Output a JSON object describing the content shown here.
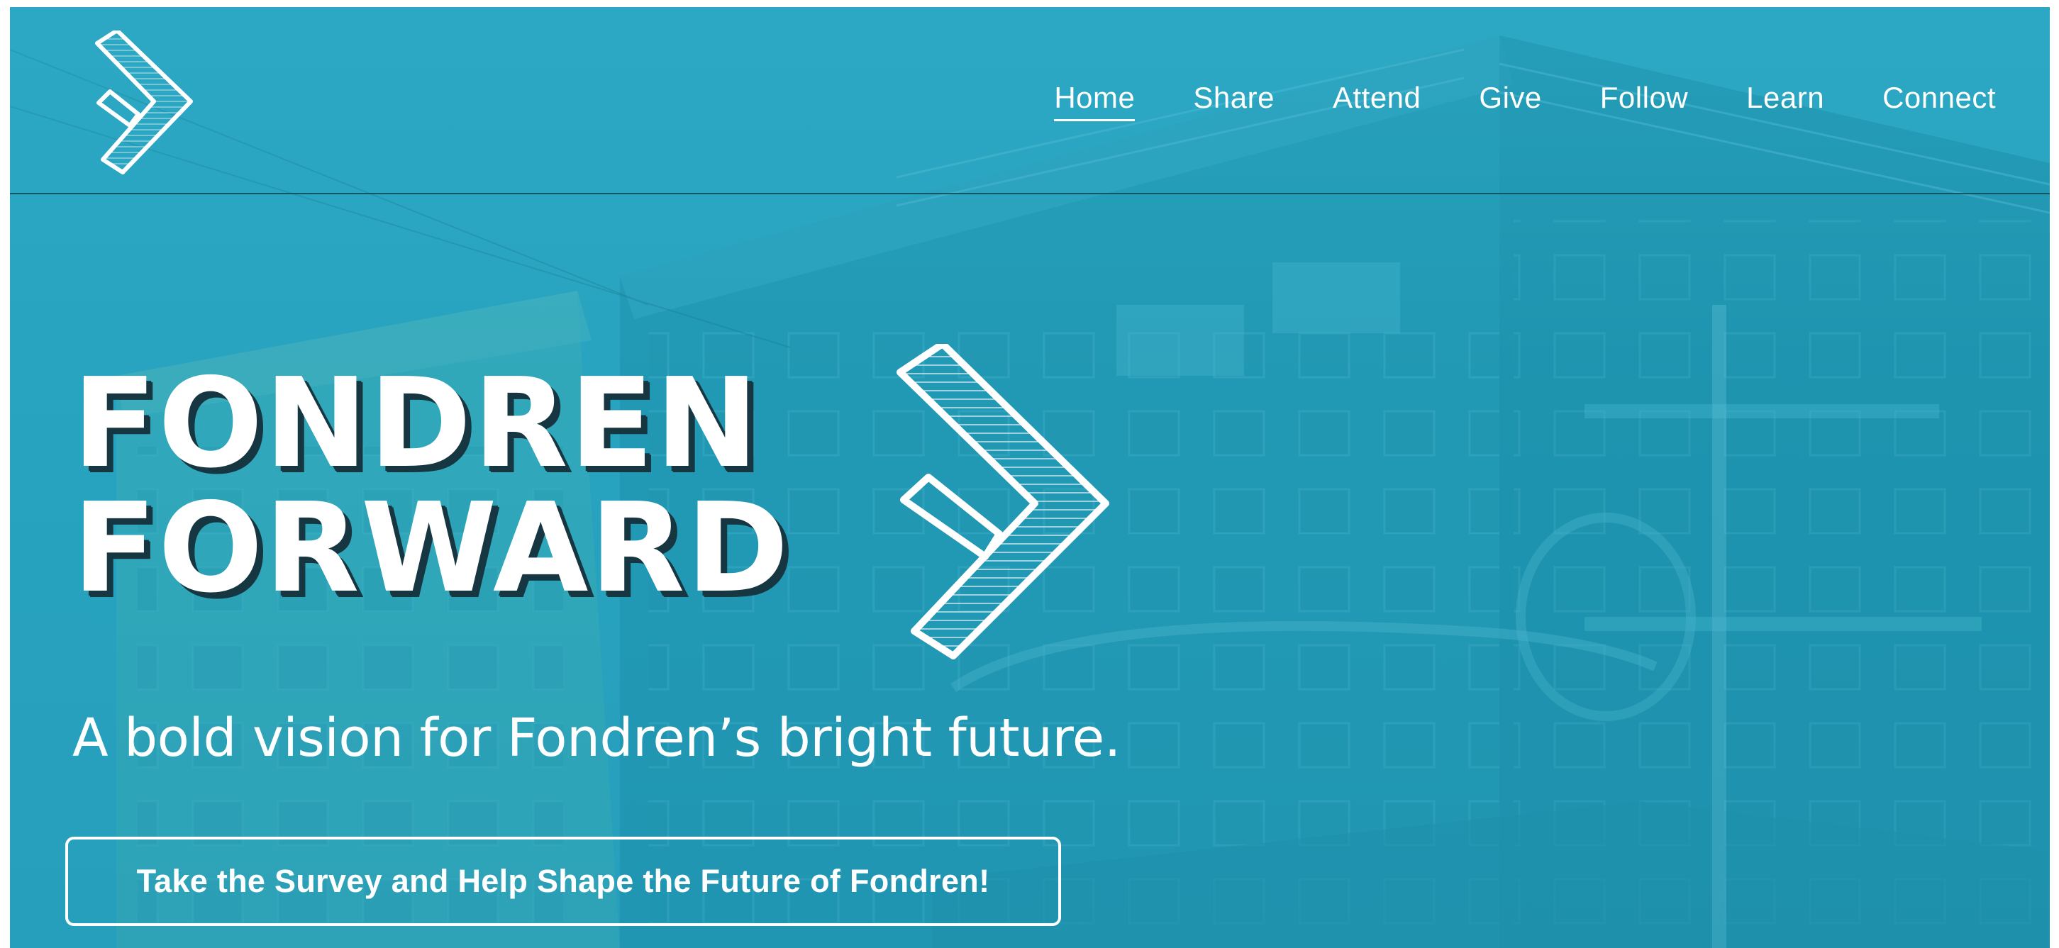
{
  "brand": {
    "logo_icon": "chevron-arrow-logo"
  },
  "nav": {
    "items": [
      {
        "label": "Home",
        "active": true
      },
      {
        "label": "Share",
        "active": false
      },
      {
        "label": "Attend",
        "active": false
      },
      {
        "label": "Give",
        "active": false
      },
      {
        "label": "Follow",
        "active": false
      },
      {
        "label": "Learn",
        "active": false
      },
      {
        "label": "Connect",
        "active": false
      }
    ]
  },
  "hero": {
    "title_line1": "FONDREN",
    "title_line2": "FORWARD",
    "tagline": "A bold vision for Fondren’s bright future.",
    "cta_label": "Take the Survey and Help Shape the Future of Fondren!"
  },
  "colors": {
    "background_teal": "#27a2bf",
    "text": "#ffffff",
    "shadow": "#163641"
  }
}
